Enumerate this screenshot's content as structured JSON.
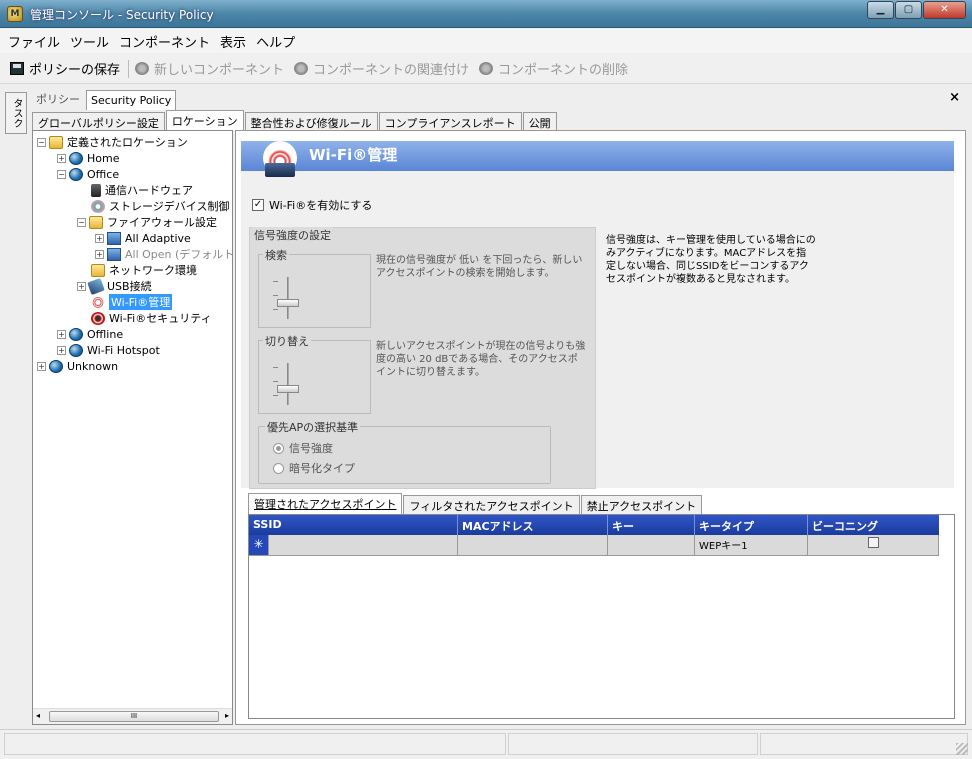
{
  "window": {
    "title": "管理コンソール - Security Policy",
    "minimize": "▁",
    "maximize": "▢",
    "close": "✕"
  },
  "menu": [
    "ファイル",
    "ツール",
    "コンポーネント",
    "表示",
    "ヘルプ"
  ],
  "toolbar": {
    "save": "ポリシーの保存",
    "new_component": "新しいコンポーネント",
    "link_component": "コンポーネントの関連付け",
    "delete_component": "コンポーネントの削除"
  },
  "tasks_label": "タスク",
  "policy_bar": {
    "label": "ポリシー",
    "name": "Security Policy",
    "close": "×"
  },
  "tabs": [
    "グローバルポリシー設定",
    "ロケーション",
    "整合性および修復ルール",
    "コンプライアンスレポート",
    "公開"
  ],
  "tree": {
    "root": "定義されたロケーション",
    "home": "Home",
    "office": "Office",
    "comm_hw": "通信ハードウェア",
    "storage": "ストレージデバイス制御",
    "firewall": "ファイアウォール設定",
    "all_adaptive": "All Adaptive",
    "all_open": "All Open (デフォルト",
    "network": "ネットワーク環境",
    "usb": "USB接続",
    "wifi_mgmt": "Wi-Fi®管理",
    "wifi_sec": "Wi-Fi®セキュリティ",
    "offline": "Offline",
    "hotspot": "Wi-Fi Hotspot",
    "unknown": "Unknown"
  },
  "scroll": {
    "left": "◂",
    "thumb": "III",
    "right": "▸"
  },
  "header": {
    "title": "Wi-Fi®管理"
  },
  "enable": {
    "label": "Wi-Fi®を有効にする",
    "checked": true,
    "mark": "✓"
  },
  "signal": {
    "group": "信号強度の設定",
    "search": "検索",
    "search_desc": "現在の信号強度が 低い を下回ったら、新しいアクセスポイントの検索を開始します。",
    "switch": "切り替え",
    "switch_desc": "新しいアクセスポイントが現在の信号よりも強度の高い 20 dBである場合、そのアクセスポイントに切り替えます。",
    "priority": "優先APの選択基準",
    "opt1": "信号強度",
    "opt2": "暗号化タイプ",
    "selected": "信号強度"
  },
  "info": "信号強度は、キー管理を使用している場合にのみアクティブになります。MACアドレスを指定しない場合、同じSSIDをビーコンするアクセスポイントが複数あると見なされます。",
  "subtabs": [
    "管理されたアクセスポイント",
    "フィルタされたアクセスポイント",
    "禁止アクセスポイント"
  ],
  "grid": {
    "columns": [
      "SSID",
      "MACアドレス",
      "キー",
      "キータイプ",
      "ビーコニング"
    ],
    "rows": [
      {
        "marker": "✳",
        "ssid": "",
        "mac": "",
        "key": "",
        "keytype": "WEPキー1",
        "beacon": false
      }
    ]
  },
  "colors": {
    "header": "#5a86d6",
    "selection": "#3399ff",
    "grid_head": "#1c3c9c"
  }
}
